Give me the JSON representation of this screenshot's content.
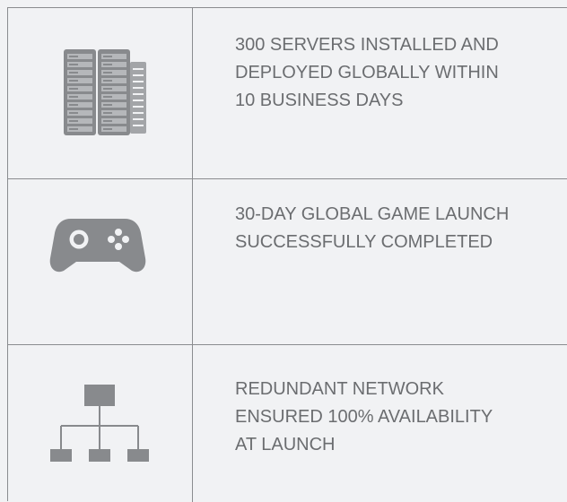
{
  "colors": {
    "background": "#f1f2f4",
    "grid_line": "#8a8c8f",
    "icon": "#888a8d",
    "text": "#6b6d70"
  },
  "features": [
    {
      "icon": "server-rack-icon",
      "text": "300 SERVERS INSTALLED AND\nDEPLOYED GLOBALLY WITHIN\n10 BUSINESS DAYS"
    },
    {
      "icon": "game-controller-icon",
      "text": "30-DAY GLOBAL GAME LAUNCH\nSUCCESSFULLY COMPLETED"
    },
    {
      "icon": "network-hierarchy-icon",
      "text": "REDUNDANT NETWORK\nENSURED 100% AVAILABILITY\nAT LAUNCH"
    }
  ]
}
